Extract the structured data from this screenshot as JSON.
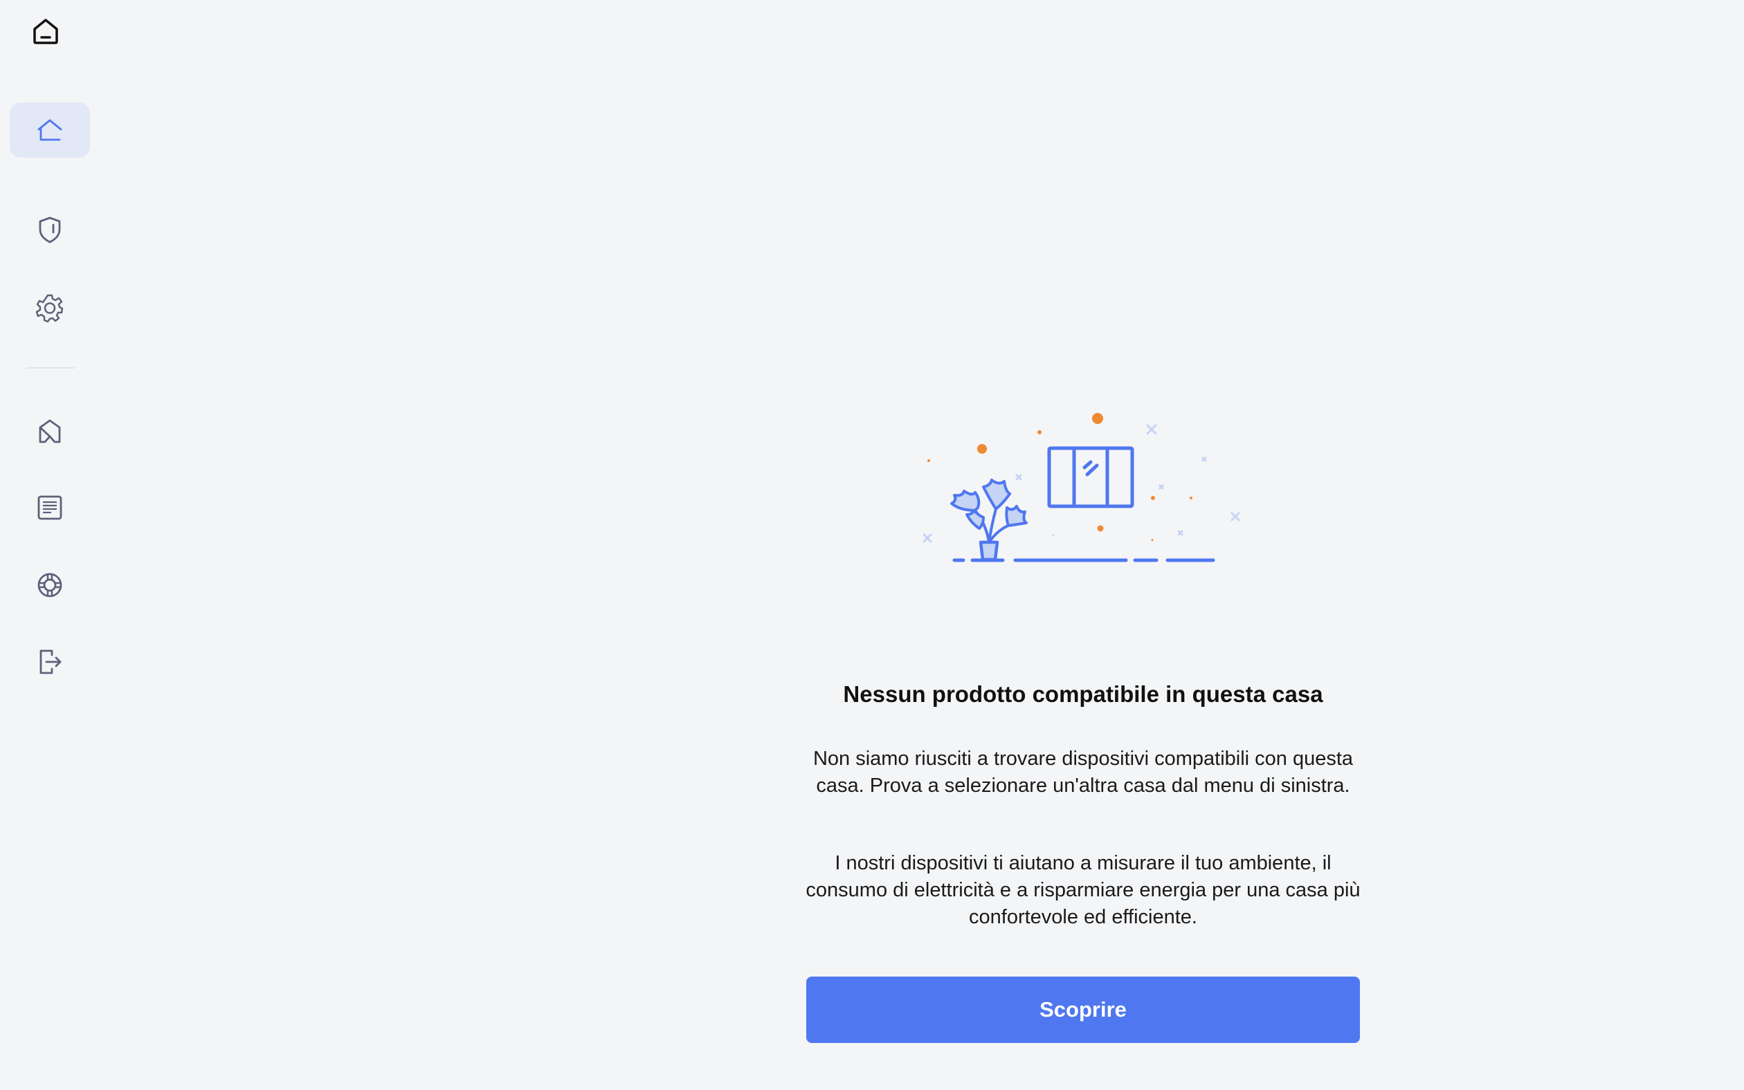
{
  "sidebar": {
    "logo_icon": "home-logo-icon",
    "items": [
      {
        "name": "home",
        "icon": "home-icon",
        "active": true
      },
      {
        "name": "security",
        "icon": "shield-icon",
        "active": false
      },
      {
        "name": "settings",
        "icon": "gear-icon",
        "active": false
      },
      {
        "name": "products",
        "icon": "house-tag-icon",
        "active": false
      },
      {
        "name": "news",
        "icon": "news-icon",
        "active": false
      },
      {
        "name": "support",
        "icon": "lifebuoy-icon",
        "active": false
      },
      {
        "name": "logout",
        "icon": "logout-icon",
        "active": false
      }
    ]
  },
  "empty_state": {
    "illustration_icon": "plant-window-illustration",
    "title": "Nessun prodotto compatibile in questa casa",
    "paragraph_1": "Non siamo riusciti a trovare dispositivi compatibili con questa casa. Prova a selezionare un'altra casa dal menu di sinistra.",
    "paragraph_2": "I nostri dispositivi ti aiutano a misurare il tuo ambiente, il consumo di elettricità e a risparmiare energia per una casa più confortevole ed efficiente.",
    "button_label": "Scoprire"
  },
  "colors": {
    "accent": "#4f77ef",
    "illustration_orange": "#ee8a34",
    "icon_gray": "#5d6178",
    "active_bg": "#e2e8f5",
    "background": "#f4f5f7"
  }
}
